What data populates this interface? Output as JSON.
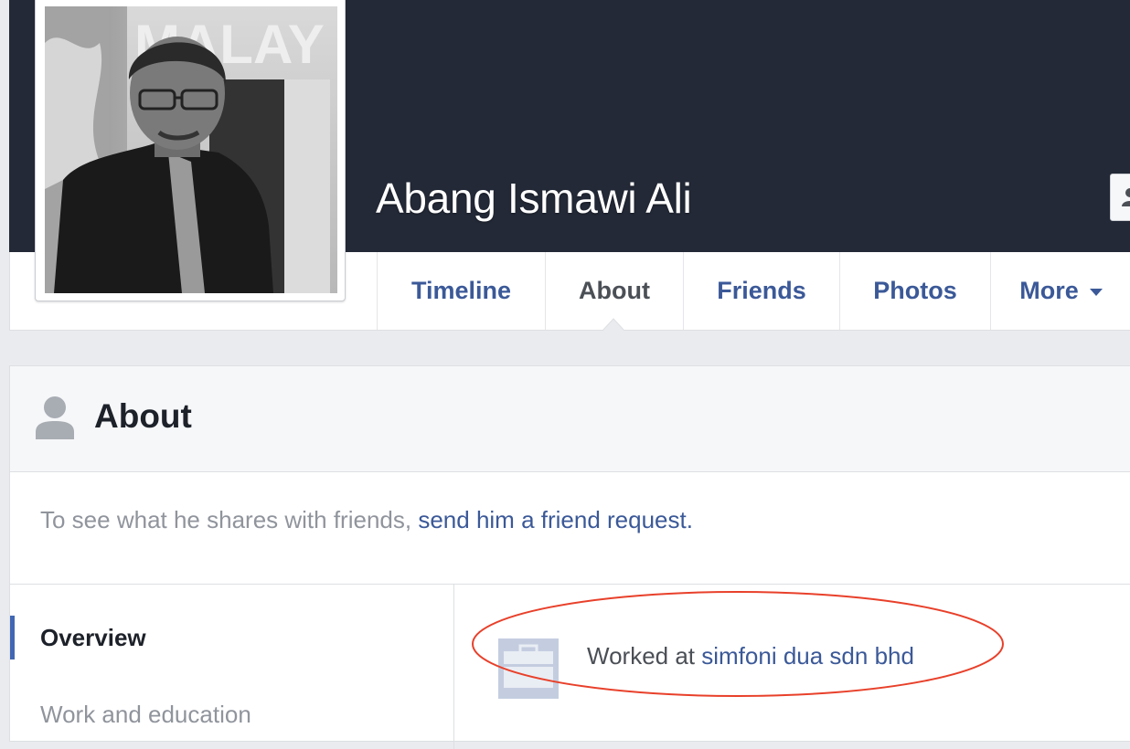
{
  "profile": {
    "name": "Abang Ismawi Ali",
    "photo_text": "MALAY"
  },
  "nav": {
    "tabs": [
      {
        "label": "Timeline"
      },
      {
        "label": "About"
      },
      {
        "label": "Friends"
      },
      {
        "label": "Photos"
      },
      {
        "label": "More"
      }
    ]
  },
  "about": {
    "title": "About",
    "notice_prefix": "To see what he shares with friends,",
    "notice_link": "send him a friend request.",
    "sidebar": [
      {
        "label": "Overview"
      },
      {
        "label": "Work and education"
      }
    ],
    "work": {
      "prefix": "Worked at",
      "company": "simfoni dua sdn bhd"
    }
  },
  "colors": {
    "cover": "#232937",
    "link": "#3b5998",
    "annotation": "#e8402a"
  }
}
